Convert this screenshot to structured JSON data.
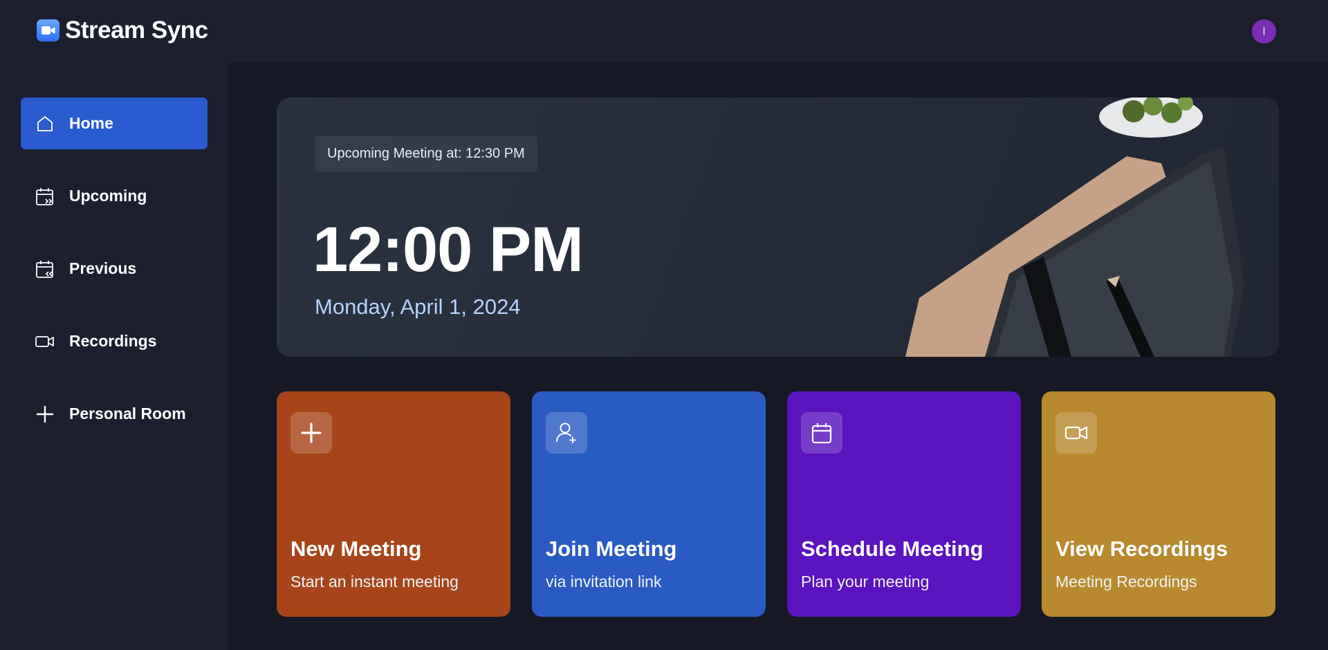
{
  "app": {
    "name": "Stream Sync"
  },
  "user": {
    "avatar_initial": "I",
    "avatar_color": "#7b2fb5"
  },
  "sidebar": {
    "items": [
      {
        "label": "Home",
        "icon": "home-icon",
        "active": true
      },
      {
        "label": "Upcoming",
        "icon": "calendar-upcoming-icon",
        "active": false
      },
      {
        "label": "Previous",
        "icon": "calendar-previous-icon",
        "active": false
      },
      {
        "label": "Recordings",
        "icon": "video-icon",
        "active": false
      },
      {
        "label": "Personal Room",
        "icon": "plus-icon",
        "active": false
      }
    ]
  },
  "hero": {
    "upcoming_text": "Upcoming Meeting at: 12:30 PM",
    "time": "12:00 PM",
    "date": "Monday, April 1, 2024"
  },
  "cards": [
    {
      "title": "New Meeting",
      "subtitle": "Start an instant meeting",
      "icon": "plus-icon",
      "color": "#a6451a"
    },
    {
      "title": "Join Meeting",
      "subtitle": "via invitation link",
      "icon": "user-add-icon",
      "color": "#2a5bc2"
    },
    {
      "title": "Schedule Meeting",
      "subtitle": "Plan your meeting",
      "icon": "calendar-icon",
      "color": "#5b12bf"
    },
    {
      "title": "View Recordings",
      "subtitle": "Meeting Recordings",
      "icon": "video-icon",
      "color": "#b8892f"
    }
  ],
  "colors": {
    "background": "#1c1f2e",
    "main_background": "#161925",
    "accent": "#2a5bd0"
  }
}
